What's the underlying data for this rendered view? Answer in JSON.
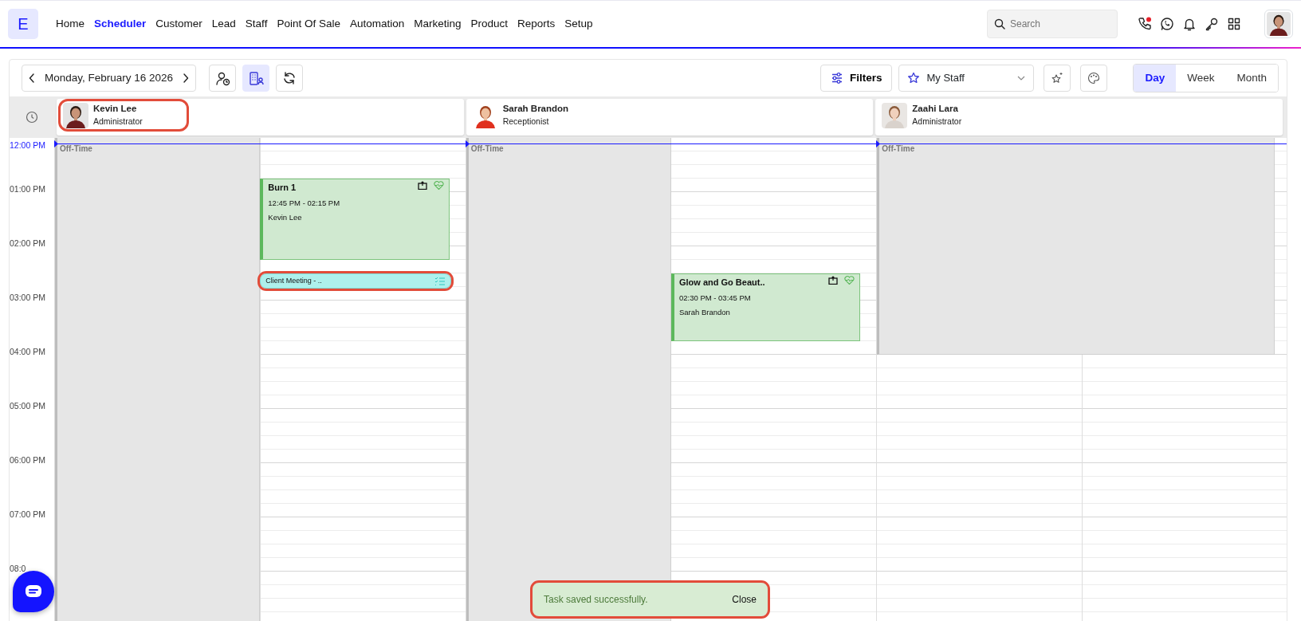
{
  "nav": {
    "logo": "E",
    "items": [
      {
        "label": "Home",
        "selected": false
      },
      {
        "label": "Scheduler",
        "selected": true
      },
      {
        "label": "Customer",
        "selected": false
      },
      {
        "label": "Lead",
        "selected": false
      },
      {
        "label": "Staff",
        "selected": false
      },
      {
        "label": "Point Of Sale",
        "selected": false
      },
      {
        "label": "Automation",
        "selected": false
      },
      {
        "label": "Marketing",
        "selected": false
      },
      {
        "label": "Product",
        "selected": false
      },
      {
        "label": "Reports",
        "selected": false
      },
      {
        "label": "Setup",
        "selected": false
      }
    ],
    "search": {
      "placeholder": "Search"
    },
    "phone_alert": true
  },
  "toolbar": {
    "date": "Monday, February 16 2026",
    "tools": [
      {
        "kind": "staff-time",
        "selected": false
      },
      {
        "kind": "resources",
        "selected": true
      },
      {
        "kind": "refresh",
        "selected": false
      }
    ],
    "filters": "Filters",
    "staff_select": "My Staff",
    "views": [
      {
        "label": "Day",
        "selected": true
      },
      {
        "label": "Week",
        "selected": false
      },
      {
        "label": "Month",
        "selected": false
      }
    ]
  },
  "time_labels": [
    {
      "label": "12:00 PM",
      "current": true
    },
    {
      "label": "01:00 PM",
      "current": false
    },
    {
      "label": "02:00 PM",
      "current": false
    },
    {
      "label": "03:00 PM",
      "current": false
    },
    {
      "label": "04:00 PM",
      "current": false
    },
    {
      "label": "05:00 PM",
      "current": false
    },
    {
      "label": "06:00 PM",
      "current": false
    },
    {
      "label": "07:00 PM",
      "current": false
    },
    {
      "label": "08:0",
      "current": false
    }
  ],
  "now_marker": true,
  "staff": [
    {
      "name": "Kevin Lee",
      "role": "Administrator",
      "highlighted": true,
      "off_time": {
        "label": "Off-Time",
        "kind": "half"
      },
      "events": [
        {
          "kind": "appointment",
          "title": "Burn 1",
          "time": "12:45 PM - 02:15 PM",
          "person": "Kevin Lee",
          "highlighted": false
        },
        {
          "kind": "task",
          "title": "Client Meeting - ..",
          "highlighted": true
        }
      ]
    },
    {
      "name": "Sarah Brandon",
      "role": "Receptionist",
      "highlighted": false,
      "off_time": {
        "label": "Off-Time",
        "kind": "half"
      },
      "events": [
        {
          "kind": "appointment",
          "title": "Glow and Go Beaut..",
          "time": "02:30 PM - 03:45 PM",
          "person": "Sarah Brandon",
          "highlighted": false
        }
      ]
    },
    {
      "name": "Zaahi Lara",
      "role": "Administrator",
      "highlighted": false,
      "off_time": {
        "label": "Off-Time",
        "kind": "full"
      }
    }
  ],
  "toast": {
    "message": "Task saved successfully.",
    "action": "Close",
    "highlighted": true
  }
}
